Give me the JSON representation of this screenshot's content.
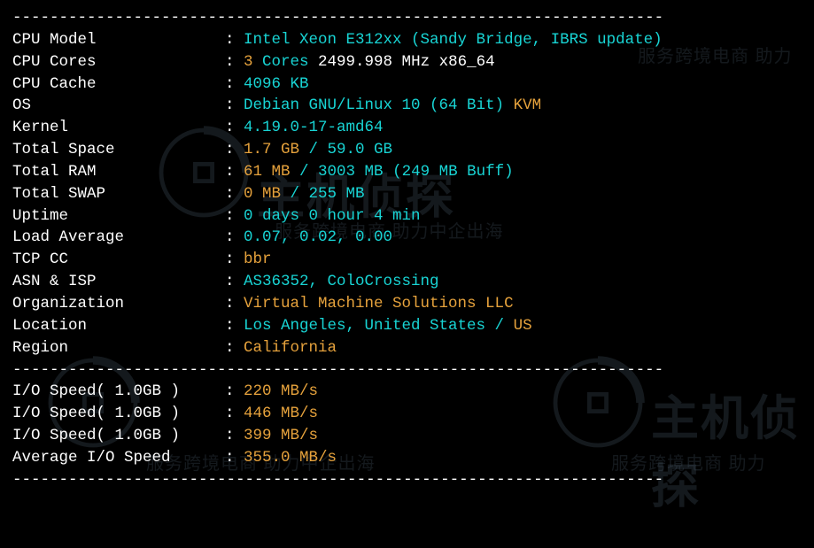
{
  "sep_top": "----------------------------------------------------------------------",
  "rows": [
    {
      "label": "CPU Model            ",
      "parts": [
        {
          "c": "cyan",
          "t": "Intel Xeon E312xx (Sandy Bridge, IBRS update)"
        }
      ]
    },
    {
      "label": "CPU Cores            ",
      "parts": [
        {
          "c": "orange",
          "t": "3"
        },
        {
          "c": "cyan",
          "t": " Cores "
        },
        {
          "c": "white",
          "t": "2499.998 MHz x86_64"
        }
      ]
    },
    {
      "label": "CPU Cache            ",
      "parts": [
        {
          "c": "cyan",
          "t": "4096 KB"
        }
      ]
    },
    {
      "label": "OS                   ",
      "parts": [
        {
          "c": "cyan",
          "t": "Debian GNU/Linux 10 (64 Bit) "
        },
        {
          "c": "orange",
          "t": "KVM"
        }
      ]
    },
    {
      "label": "Kernel               ",
      "parts": [
        {
          "c": "cyan",
          "t": "4.19.0-17-amd64"
        }
      ]
    },
    {
      "label": "Total Space          ",
      "parts": [
        {
          "c": "orange",
          "t": "1.7 GB "
        },
        {
          "c": "cyan",
          "t": "/ "
        },
        {
          "c": "cyan",
          "t": "59.0 GB"
        }
      ]
    },
    {
      "label": "Total RAM            ",
      "parts": [
        {
          "c": "orange",
          "t": "61 MB "
        },
        {
          "c": "cyan",
          "t": "/ "
        },
        {
          "c": "cyan",
          "t": "3003 MB "
        },
        {
          "c": "cyan",
          "t": "("
        },
        {
          "c": "cyan",
          "t": "249 MB Buff"
        },
        {
          "c": "cyan",
          "t": ")"
        }
      ]
    },
    {
      "label": "Total SWAP           ",
      "parts": [
        {
          "c": "orange",
          "t": "0 MB "
        },
        {
          "c": "cyan",
          "t": "/ "
        },
        {
          "c": "cyan",
          "t": "255 MB"
        }
      ]
    },
    {
      "label": "Uptime               ",
      "parts": [
        {
          "c": "cyan",
          "t": "0 days 0 hour 4 min"
        }
      ]
    },
    {
      "label": "Load Average         ",
      "parts": [
        {
          "c": "cyan",
          "t": "0.07, 0.02, 0.00"
        }
      ]
    },
    {
      "label": "TCP CC               ",
      "parts": [
        {
          "c": "orange",
          "t": "bbr"
        }
      ]
    },
    {
      "label": "ASN & ISP            ",
      "parts": [
        {
          "c": "cyan",
          "t": "AS36352, ColoCrossing"
        }
      ]
    },
    {
      "label": "Organization         ",
      "parts": [
        {
          "c": "orange",
          "t": "Virtual Machine Solutions LLC"
        }
      ]
    },
    {
      "label": "Location             ",
      "parts": [
        {
          "c": "cyan",
          "t": "Los Angeles, United States / "
        },
        {
          "c": "orange",
          "t": "US"
        }
      ]
    },
    {
      "label": "Region               ",
      "parts": [
        {
          "c": "orange",
          "t": "California"
        }
      ]
    }
  ],
  "sep_mid": "----------------------------------------------------------------------",
  "io_rows": [
    {
      "label": "I/O Speed( 1.0GB )   ",
      "parts": [
        {
          "c": "orange",
          "t": "220 MB/s"
        }
      ]
    },
    {
      "label": "I/O Speed( 1.0GB )   ",
      "parts": [
        {
          "c": "orange",
          "t": "446 MB/s"
        }
      ]
    },
    {
      "label": "I/O Speed( 1.0GB )   ",
      "parts": [
        {
          "c": "orange",
          "t": "399 MB/s"
        }
      ]
    },
    {
      "label": "Average I/O Speed    ",
      "parts": [
        {
          "c": "orange",
          "t": "355.0 MB/s"
        }
      ]
    }
  ],
  "sep_bot": "----------------------------------------------------------------------",
  "watermark": {
    "big": "主机侦探",
    "small1": "服务跨境电商 助力中企出海",
    "small2": "服务跨境电商 助力中企出海",
    "small3": "服务跨境电商 助力"
  }
}
